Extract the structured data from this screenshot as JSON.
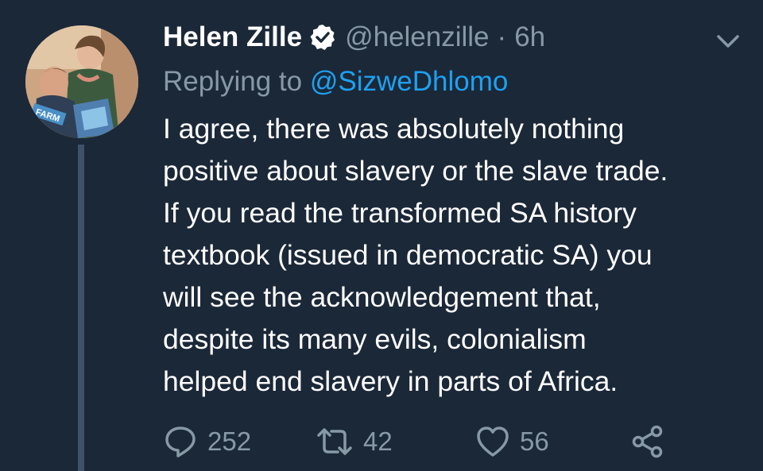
{
  "tweet": {
    "author_name": "Helen Zille",
    "handle": "@helenzille",
    "separator": "·",
    "time": "6h",
    "replying_prefix": "Replying to ",
    "replying_to": "@SizweDhlomo",
    "body_lines": [
      "I agree, there was absolutely nothing",
      "positive about slavery or the slave trade.",
      "If you read the transformed SA history",
      "textbook (issued in democratic SA) you",
      "will see the acknowledgement that,",
      "despite its many evils, colonialism",
      "helped end slavery in parts of Africa."
    ],
    "avatar_label": "FARM"
  },
  "actions": {
    "reply_count": "252",
    "retweet_count": "42",
    "like_count": "56"
  },
  "icons": {
    "verified": "verified-badge-icon",
    "menu": "chevron-down-icon",
    "reply": "reply-icon",
    "retweet": "retweet-icon",
    "like": "heart-icon",
    "share": "share-icon"
  },
  "colors": {
    "background": "#1b2838",
    "primary_text": "#ffffff",
    "secondary_text": "#8899a6",
    "link": "#1da1f2",
    "thread_line": "#3e5166"
  }
}
